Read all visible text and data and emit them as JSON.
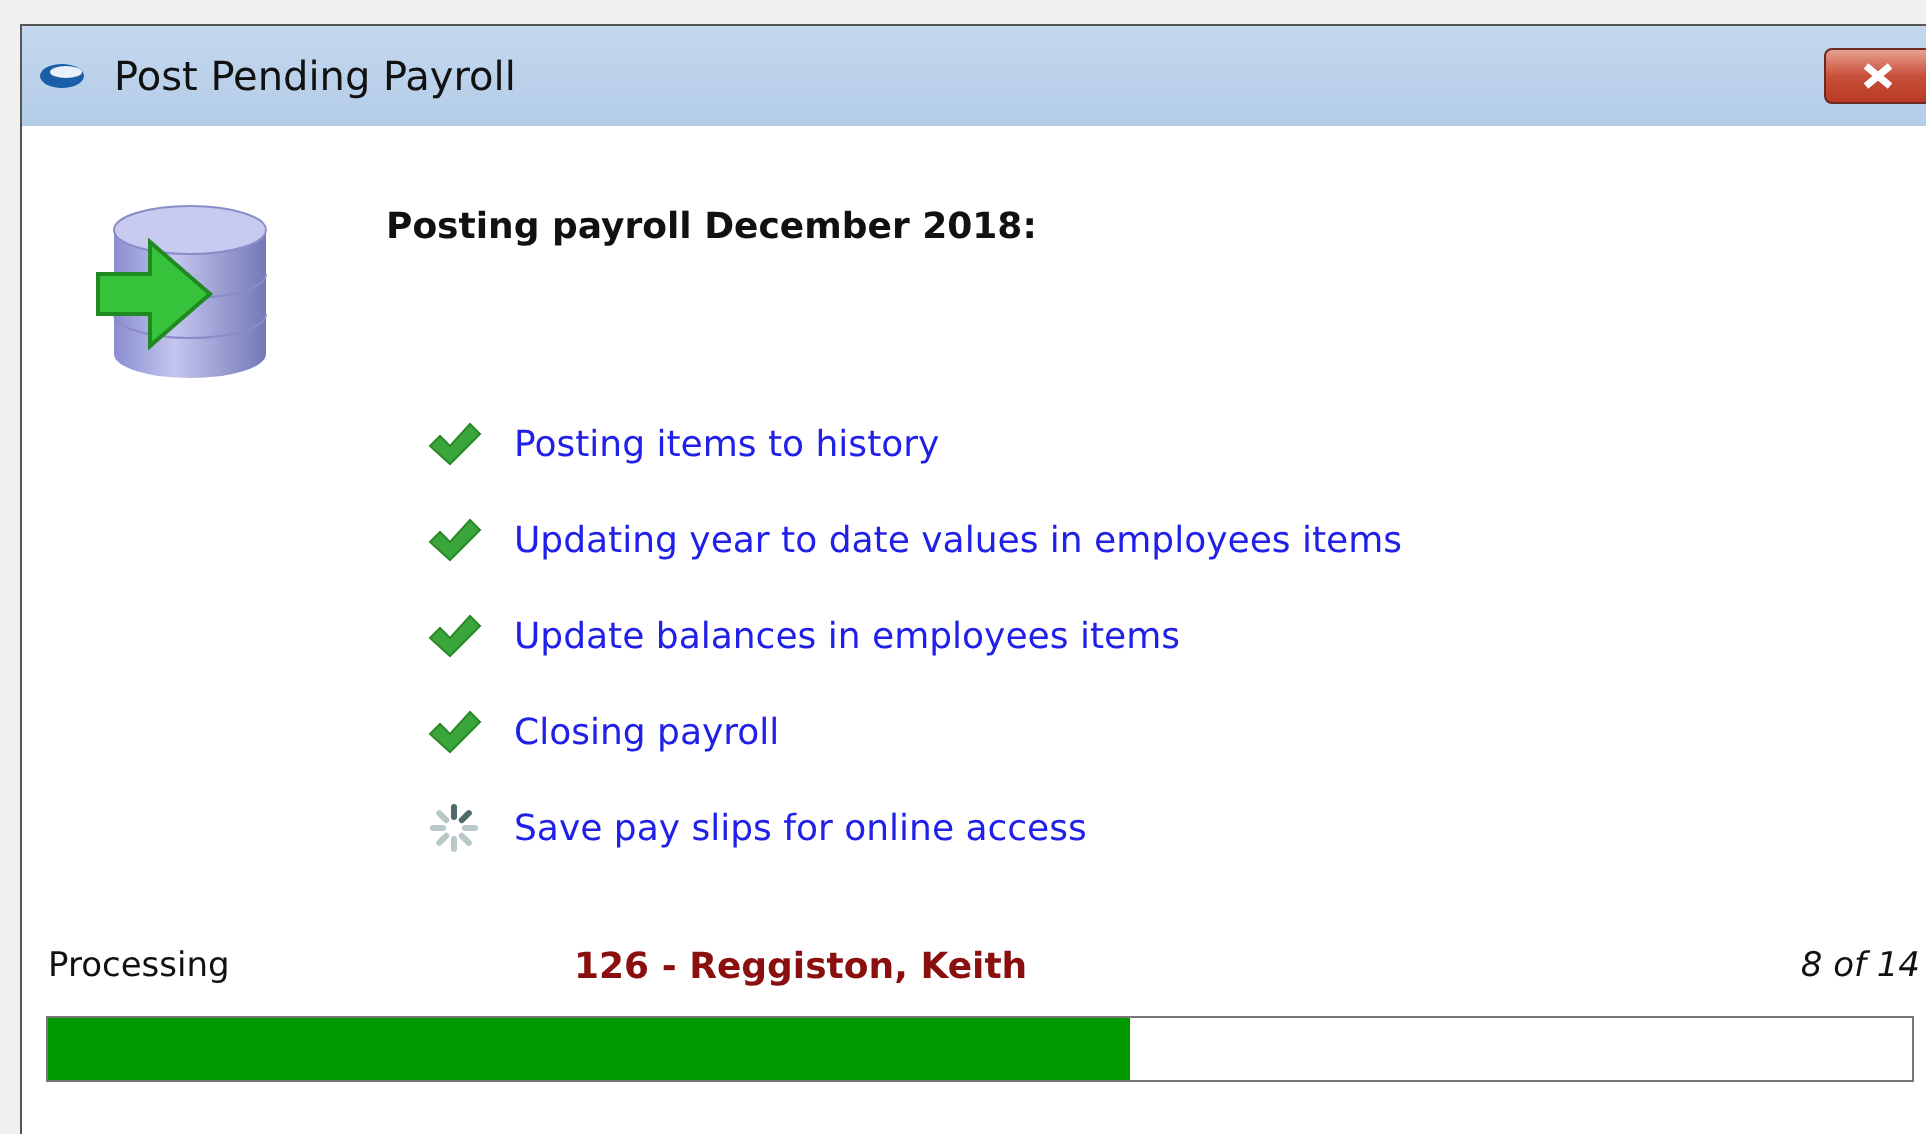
{
  "window": {
    "title": "Post Pending Payroll"
  },
  "heading": "Posting payroll December 2018:",
  "steps": [
    {
      "label": "Posting items to history",
      "kind": "done"
    },
    {
      "label": "Updating year to date values in employees items",
      "kind": "done"
    },
    {
      "label": "Update balances in employees items",
      "kind": "done"
    },
    {
      "label": "Closing payroll",
      "kind": "done"
    },
    {
      "label": "Save pay slips for online access",
      "kind": "busy"
    }
  ],
  "progress": {
    "label": "Processing",
    "current": "126 - Reggiston, Keith",
    "count": "8 of 14",
    "level": 0.58
  }
}
